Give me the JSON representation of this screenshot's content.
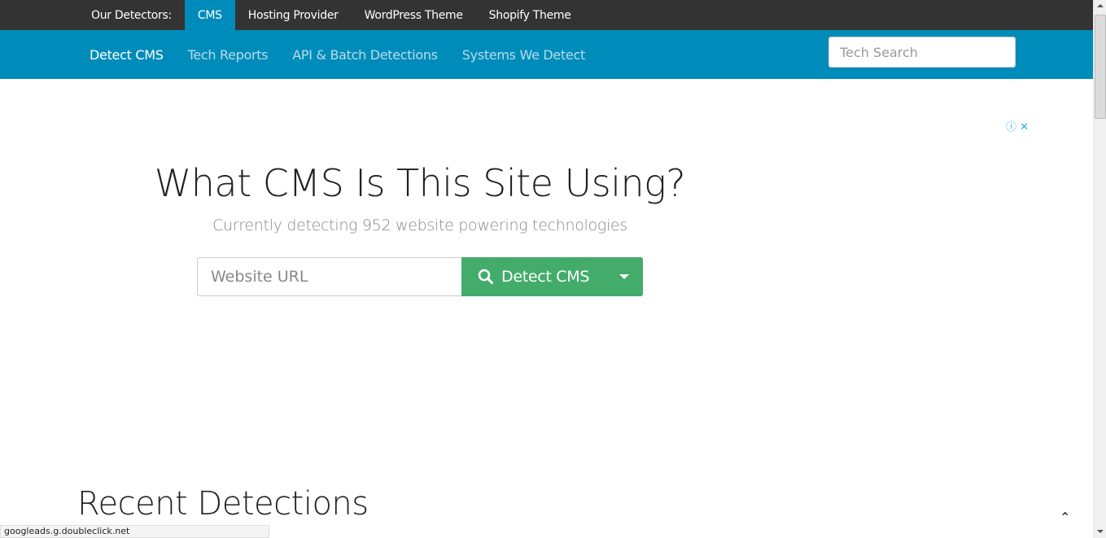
{
  "topbar": {
    "label": "Our Detectors:",
    "items": [
      "CMS",
      "Hosting Provider",
      "WordPress Theme",
      "Shopify Theme"
    ],
    "active": "CMS"
  },
  "subnav": {
    "items": [
      "Detect CMS",
      "Tech Reports",
      "API & Batch Detections",
      "Systems We Detect"
    ],
    "search_placeholder": "Tech Search"
  },
  "hero": {
    "title": "What CMS Is This Site Using?",
    "subtitle": "Currently detecting 952 website powering technologies",
    "url_placeholder": "Website URL",
    "button": "Detect CMS"
  },
  "recent": {
    "title": "Recent Detections"
  },
  "status_bar": "googleads.g.doubleclick.net",
  "colors": {
    "topbar": "#333333",
    "accent": "#008cba",
    "button": "#43ac6a"
  }
}
